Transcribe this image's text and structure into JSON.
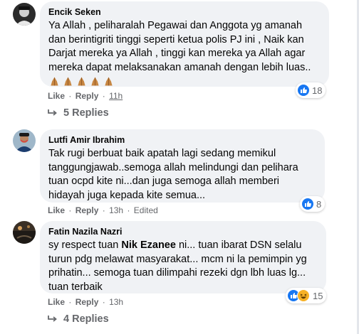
{
  "comments": [
    {
      "author": "Encik Seken",
      "lines": [
        "Ya Allah , peliharalah Pegawai dan Anggota yg amanah",
        "dan berintigriti tinggi seperti ketua polis PJ ini , Naik kan",
        "Darjat mereka ya Allah , tinggi kan mereka ya Allah agar",
        "mereka dapat melaksanakan amanah dengan lebih luas.."
      ],
      "emoji": [
        "folded-hands",
        "folded-hands",
        "folded-hands",
        "folded-hands",
        "folded-hands"
      ],
      "like_label": "Like",
      "reply_label": "Reply",
      "dot": "·",
      "time": "11h",
      "reaction_count": "18",
      "reaction_icons": [
        "like-icon"
      ],
      "replies_label": "5 Replies"
    },
    {
      "author": "Lutfi Amir Ibrahim",
      "lines": [
        "Tak rugi berbuat baik apatah lagi sedang memikul",
        "tanggungjawab..semoga allah melindungi dan pelihara",
        "tuan ocpd kite ni...dan juga semoga allah memberi",
        "hidayah juga kepada kite semua..."
      ],
      "like_label": "Like",
      "reply_label": "Reply",
      "dot": "·",
      "time": "13h",
      "edited": "Edited",
      "reaction_count": "8",
      "reaction_icons": [
        "like-icon"
      ]
    },
    {
      "author": "Fatin Nazila Nazri",
      "line1_pre": "sy respect tuan ",
      "mention": "Nik Ezanee",
      "line1_post": " ni... tuan ibarat DSN selalu",
      "lines": [
        "turun pdg melawat masyarakat... mcm ni la pemimpin yg",
        "prihatin... semoga tuan dilimpahi rezeki dgn lbh luas lg...",
        "tuan terbaik"
      ],
      "like_label": "Like",
      "reply_label": "Reply",
      "dot": "·",
      "time": "13h",
      "reaction_count": "15",
      "reaction_icons": [
        "like-icon",
        "haha-icon"
      ],
      "replies_label": "4 Replies"
    }
  ],
  "colors": {
    "like_blue": "#1877f2",
    "haha_yellow": "#f7b125",
    "bubble": "#f0f2f5",
    "meta_gray": "#65676b"
  }
}
